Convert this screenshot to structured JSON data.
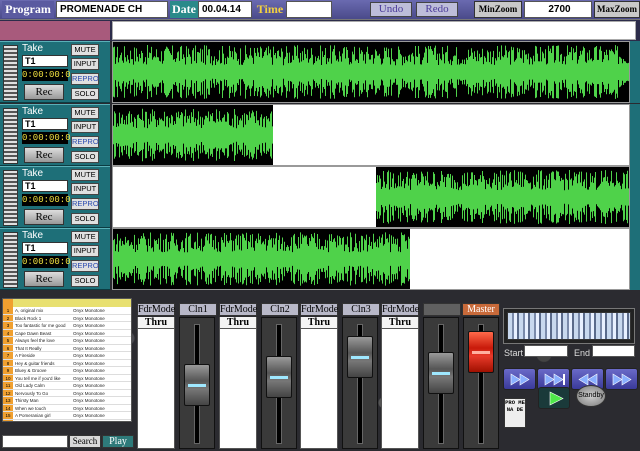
{
  "header": {
    "program_label": "Program",
    "program_value": "PROMENADE CH",
    "date_label": "Date",
    "date_value": "00.04.14",
    "time_label": "Time",
    "time_value": "",
    "undo_label": "Undo",
    "redo_label": "Redo",
    "minzoom_label": "MinZoom",
    "zoom_value": "2700",
    "maxzoom_label": "MaxZoom"
  },
  "tracks": [
    {
      "take_label": "Take",
      "take_value": "T1",
      "time": "0:00:00:0",
      "rec_label": "Rec",
      "mute": "MUTE",
      "input": "INPUT",
      "repro": "REPRO",
      "solo": "SOLO"
    },
    {
      "take_label": "Take",
      "take_value": "T1",
      "time": "0:00:00:0",
      "rec_label": "Rec",
      "mute": "MUTE",
      "input": "INPUT",
      "repro": "REPRO",
      "solo": "SOLO"
    },
    {
      "take_label": "Take",
      "take_value": "T1",
      "time": "0:00:00:0",
      "rec_label": "Rec",
      "mute": "MUTE",
      "input": "INPUT",
      "repro": "REPRO",
      "solo": "SOLO"
    },
    {
      "take_label": "Take",
      "take_value": "T1",
      "time": "0:00:00:0",
      "rec_label": "Rec",
      "mute": "MUTE",
      "input": "INPUT",
      "repro": "REPRO",
      "solo": "SOLO"
    }
  ],
  "waveform_colors": {
    "wave": "#4fd24a",
    "bg": "#000000"
  },
  "mixer": {
    "channels": [
      {
        "label": "FdrMode",
        "mode": "Thru",
        "fader_label": "Cln1",
        "fader_level": 0.45
      },
      {
        "label": "FdrMode",
        "mode": "Thru",
        "fader_label": "Cln2",
        "fader_level": 0.55
      },
      {
        "label": "FdrMode",
        "mode": "Thru",
        "fader_label": "Cln3",
        "fader_level": 0.78
      },
      {
        "label": "FdrMode",
        "mode": "Thru",
        "fader_label": "",
        "fader_level": 0.6
      }
    ],
    "master_label": "Master",
    "master_level": 0.85
  },
  "playlist": {
    "headers": [
      "",
      "",
      ""
    ],
    "rows": [
      {
        "num": "1",
        "c1": "A, original mix",
        "c2": "Onyx Monotone"
      },
      {
        "num": "2",
        "c1": "Black Rock 1",
        "c2": "Onyx Monotone"
      },
      {
        "num": "3",
        "c1": "Too fantastic for me good",
        "c2": "Onyx Monotone"
      },
      {
        "num": "4",
        "c1": "Cape Dawn Beast",
        "c2": "Onyx Monotone"
      },
      {
        "num": "5",
        "c1": "Always feel the love",
        "c2": "Onyx Monotone"
      },
      {
        "num": "6",
        "c1": "That It Really",
        "c2": "Onyx Monotone"
      },
      {
        "num": "7",
        "c1": "A Fireside",
        "c2": "Onyx Monotone"
      },
      {
        "num": "8",
        "c1": "Hey & guitar friends",
        "c2": "Onyx Monotone"
      },
      {
        "num": "9",
        "c1": "Bluey & Groove",
        "c2": "Onyx Monotone"
      },
      {
        "num": "10",
        "c1": "You tell me if you'd like",
        "c2": "Onyx Monotone"
      },
      {
        "num": "11",
        "c1": "Old Lady Calm",
        "c2": "Onyx Monotone"
      },
      {
        "num": "12",
        "c1": "Nervously To Go",
        "c2": "Onyx Monotone"
      },
      {
        "num": "13",
        "c1": "Thirsty Man",
        "c2": "Onyx Monotone"
      },
      {
        "num": "14",
        "c1": "When we touch",
        "c2": "Onyx Monotone"
      },
      {
        "num": "15",
        "c1": "A Pomeranian girl",
        "c2": "Onyx Monotone"
      },
      {
        "num": "16",
        "c1": "Go ahead to take you home",
        "c2": "Onyx Monotone"
      },
      {
        "num": "17",
        "c1": "In a queen Night",
        "c2": "Onyx Monotone"
      },
      {
        "num": "18",
        "c1": "Don't know how you go",
        "c2": "Onyx Monotone"
      },
      {
        "num": "19",
        "c1": "A journey somewhere else",
        "c2": "Onyx Monotone"
      },
      {
        "num": "20",
        "c1": "Don't be Your Deal",
        "c2": "Onyx Monotone"
      }
    ],
    "search_label": "Search",
    "play_label": "Play"
  },
  "transport": {
    "start_label": "Start",
    "end_label": "End",
    "standby_label": "Standby",
    "logo_text": "PRO ME NA DE"
  }
}
